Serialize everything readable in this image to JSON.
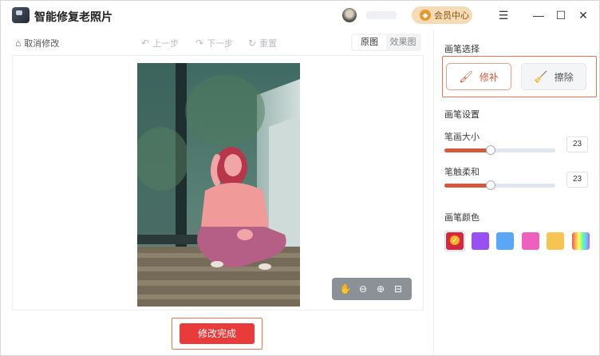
{
  "app": {
    "title": "智能修复老照片"
  },
  "header": {
    "vip_label": "会员中心",
    "vip_icon": "diamond-icon"
  },
  "window_controls": {
    "menu": "☰",
    "minimize": "—",
    "maximize": "☐",
    "close": "✕"
  },
  "toolbar": {
    "cancel_label": "取消修改",
    "undo_label": "上一步",
    "redo_label": "下一步",
    "reset_label": "重置",
    "view_tabs": [
      {
        "label": "原图",
        "active": true
      },
      {
        "label": "效果图",
        "active": false
      }
    ]
  },
  "zoom_bar": {
    "icons": [
      "hand-icon",
      "zoom-out-icon",
      "zoom-in-icon",
      "fit-icon"
    ]
  },
  "actions": {
    "done_label": "修改完成"
  },
  "panel": {
    "brush_select_title": "画笔选择",
    "brushes": [
      {
        "label": "修补",
        "active": true
      },
      {
        "label": "擦除",
        "active": false
      }
    ],
    "brush_settings_title": "画笔设置",
    "size_label": "笔画大小",
    "size_value": "23",
    "size_level_percent": 42,
    "softness_label": "笔触柔和",
    "softness_value": "23",
    "softness_level_percent": 42,
    "color_title": "画笔颜色",
    "colors": [
      "#d7263d",
      "#9a4ff0",
      "#5aa8f5",
      "#ee5fc0",
      "#f6c450",
      "rainbow"
    ],
    "selected_color_index": 0
  },
  "colors": {
    "accent": "#e8744e",
    "done_button": "#ea3b3b",
    "slider_fill": "#d2593a"
  }
}
